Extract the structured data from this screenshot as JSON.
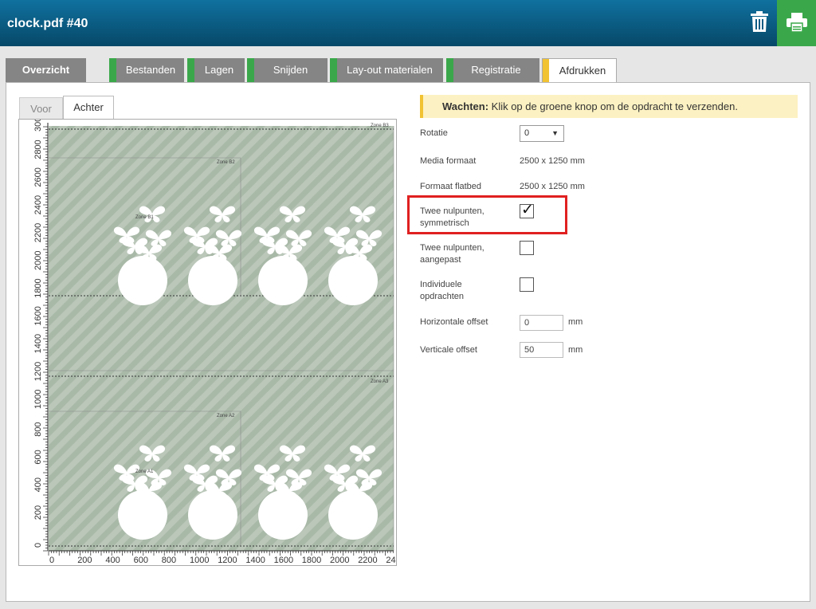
{
  "window": {
    "title": "clock.pdf #40"
  },
  "toolbar": {
    "trash_icon": "trash-icon",
    "print_icon": "printer-icon",
    "accent": "#3aa84a"
  },
  "tabs": [
    {
      "label": "Overzicht",
      "status": "none"
    },
    {
      "label": "Bestanden",
      "status": "done"
    },
    {
      "label": "Lagen",
      "status": "done"
    },
    {
      "label": "Snijden",
      "status": "done"
    },
    {
      "label": "Lay-out materialen",
      "status": "done"
    },
    {
      "label": "Registratie",
      "status": "done"
    },
    {
      "label": "Afdrukken",
      "status": "active"
    }
  ],
  "side_tabs": {
    "front": "Voor",
    "back": "Achter"
  },
  "preview": {
    "zones": [
      "Zone B3",
      "Zone B2",
      "Zone B1",
      "Zone A3",
      "Zone A2",
      "Zone A1"
    ],
    "ruler_y": [
      "3000",
      "2800",
      "2600",
      "2400",
      "2200",
      "2000",
      "1800",
      "1600",
      "1400",
      "1200",
      "1000",
      "800",
      "600",
      "400",
      "200",
      "0"
    ],
    "ruler_x": [
      "0",
      "200",
      "400",
      "600",
      "800",
      "1000",
      "1200",
      "1400",
      "1600",
      "1800",
      "2000",
      "2200",
      "24"
    ]
  },
  "banner": {
    "bold": "Wachten:",
    "text": " Klik op de groene knop om de opdracht te verzenden."
  },
  "form": {
    "rotation_label": "Rotatie",
    "rotation_value": "0",
    "media_format_label": "Media formaat",
    "media_format_value": "2500 x 1250 mm",
    "flatbed_format_label": "Formaat flatbed",
    "flatbed_format_value": "2500 x 1250 mm",
    "two_zero_sym_label_1": "Twee nulpunten,",
    "two_zero_sym_label_2": "symmetrisch",
    "two_zero_sym_checked": "✓",
    "two_zero_custom_label_1": "Twee nulpunten,",
    "two_zero_custom_label_2": "aangepast",
    "individual_label_1": "Individuele",
    "individual_label_2": "opdrachten",
    "h_offset_label": "Horizontale offset",
    "h_offset_value": "0",
    "v_offset_label": "Verticale offset",
    "v_offset_value": "50",
    "unit": "mm"
  }
}
